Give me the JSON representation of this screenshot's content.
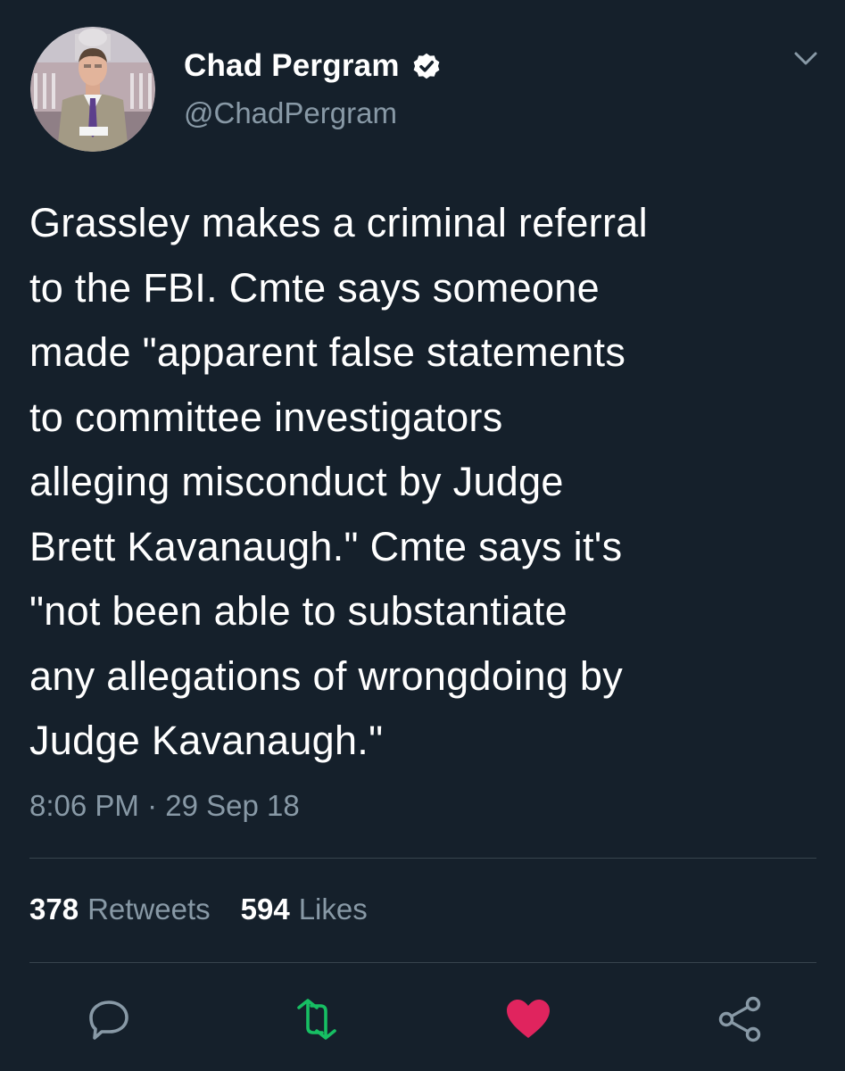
{
  "author": {
    "display_name": "Chad Pergram",
    "handle": "@ChadPergram",
    "verified": true
  },
  "tweet": {
    "text": "Grassley makes a criminal referral\nto the FBI. Cmte says someone\nmade \"apparent false statements\nto committee investigators\nalleging misconduct by Judge\nBrett Kavanaugh.\" Cmte says it's\n\"not been able to substantiate\nany allegations of wrongdoing by\nJudge Kavanaugh.\"",
    "time": "8:06 PM",
    "separator": " · ",
    "date": "29 Sep 18"
  },
  "stats": {
    "retweets_count": "378",
    "retweets_label": "Retweets",
    "likes_count": "594",
    "likes_label": "Likes"
  },
  "actions": {
    "reply_icon": "reply-icon",
    "retweet_icon": "retweet-icon",
    "like_icon": "heart-icon",
    "share_icon": "share-icon"
  },
  "colors": {
    "background": "#15202b",
    "text_primary": "#ffffff",
    "text_secondary": "#8899a6",
    "divider": "#38444d",
    "retweet_green": "#17bf63",
    "like_red": "#e0245e"
  }
}
